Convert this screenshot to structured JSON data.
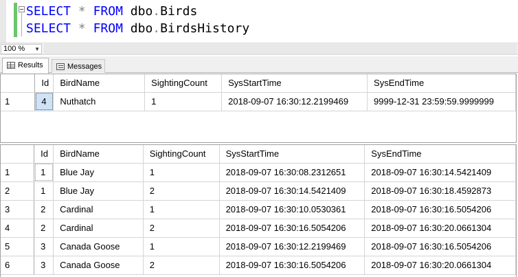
{
  "editor": {
    "line1": {
      "kw_select": "SELECT",
      "star": "*",
      "kw_from": "FROM",
      "schema": "dbo",
      "dot": ".",
      "table": "Birds"
    },
    "line2": {
      "kw_select": "SELECT",
      "star": "*",
      "kw_from": "FROM",
      "schema": "dbo",
      "dot": ".",
      "table": "BirdsHistory"
    }
  },
  "zoom": {
    "value": "100 %"
  },
  "tabs": [
    {
      "label": "Results",
      "icon": "grid-icon",
      "active": true
    },
    {
      "label": "Messages",
      "icon": "messages-icon",
      "active": false
    }
  ],
  "result1": {
    "columns": [
      "Id",
      "BirdName",
      "SightingCount",
      "SysStartTime",
      "SysEndTime"
    ],
    "rows": [
      {
        "num": "1",
        "cells": [
          "4",
          "Nuthatch",
          "1",
          "2018-09-07 16:30:12.2199469",
          "9999-12-31 23:59:59.9999999"
        ]
      }
    ]
  },
  "result2": {
    "columns": [
      "Id",
      "BirdName",
      "SightingCount",
      "SysStartTime",
      "SysEndTime"
    ],
    "rows": [
      {
        "num": "1",
        "cells": [
          "1",
          "Blue Jay",
          "1",
          "2018-09-07 16:30:08.2312651",
          "2018-09-07 16:30:14.5421409"
        ]
      },
      {
        "num": "2",
        "cells": [
          "1",
          "Blue Jay",
          "2",
          "2018-09-07 16:30:14.5421409",
          "2018-09-07 16:30:18.4592873"
        ]
      },
      {
        "num": "3",
        "cells": [
          "2",
          "Cardinal",
          "1",
          "2018-09-07 16:30:10.0530361",
          "2018-09-07 16:30:16.5054206"
        ]
      },
      {
        "num": "4",
        "cells": [
          "2",
          "Cardinal",
          "2",
          "2018-09-07 16:30:16.5054206",
          "2018-09-07 16:30:20.0661304"
        ]
      },
      {
        "num": "5",
        "cells": [
          "3",
          "Canada Goose",
          "1",
          "2018-09-07 16:30:12.2199469",
          "2018-09-07 16:30:16.5054206"
        ]
      },
      {
        "num": "6",
        "cells": [
          "3",
          "Canada Goose",
          "2",
          "2018-09-07 16:30:16.5054206",
          "2018-09-07 16:30:20.0661304"
        ]
      }
    ]
  },
  "colors": {
    "keyword": "#0000ff",
    "operator": "#808080",
    "selected_cell": "#cfe3f7",
    "change_bar": "#6cc66c"
  }
}
